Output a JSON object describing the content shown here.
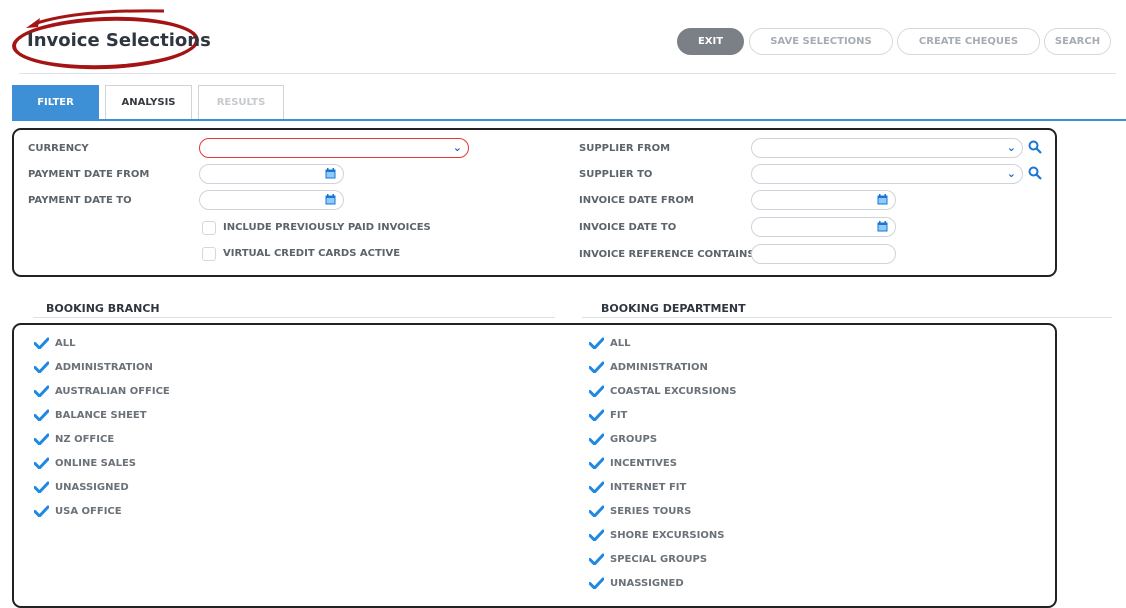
{
  "page": {
    "title": "Invoice Selections"
  },
  "toolbar": {
    "exit": "EXIT",
    "save_selections": "SAVE SELECTIONS",
    "create_cheques": "CREATE CHEQUES",
    "search": "SEARCH"
  },
  "tabs": [
    {
      "label": "FILTER",
      "state": "active"
    },
    {
      "label": "ANALYSIS",
      "state": "enabled"
    },
    {
      "label": "RESULTS",
      "state": "disabled"
    }
  ],
  "filter": {
    "currency": "CURRENCY",
    "payment_date_from": "PAYMENT DATE FROM",
    "payment_date_to": "PAYMENT DATE TO",
    "include_prev_paid": "INCLUDE PREVIOUSLY PAID INVOICES",
    "virtual_credit_cards": "VIRTUAL CREDIT CARDS ACTIVE",
    "supplier_from": "SUPPLIER FROM",
    "supplier_to": "SUPPLIER TO",
    "invoice_date_from": "INVOICE DATE FROM",
    "invoice_date_to": "INVOICE DATE TO",
    "invoice_reference_contains": "INVOICE REFERENCE CONTAINS"
  },
  "booking_branch": {
    "header": "BOOKING BRANCH",
    "items": [
      "ALL",
      "ADMINISTRATION",
      "AUSTRALIAN OFFICE",
      "BALANCE SHEET",
      "NZ OFFICE",
      "ONLINE SALES",
      "UNASSIGNED",
      "USA OFFICE"
    ]
  },
  "booking_department": {
    "header": "BOOKING DEPARTMENT",
    "items": [
      "ALL",
      "ADMINISTRATION",
      "COASTAL EXCURSIONS",
      "FIT",
      "GROUPS",
      "INCENTIVES",
      "INTERNET FIT",
      "SERIES TOURS",
      "SHORE EXCURSIONS",
      "SPECIAL GROUPS",
      "UNASSIGNED"
    ]
  },
  "colors": {
    "accent": "#3d8fd6",
    "highlight": "#a51414",
    "exit_button": "#7b7f86"
  }
}
